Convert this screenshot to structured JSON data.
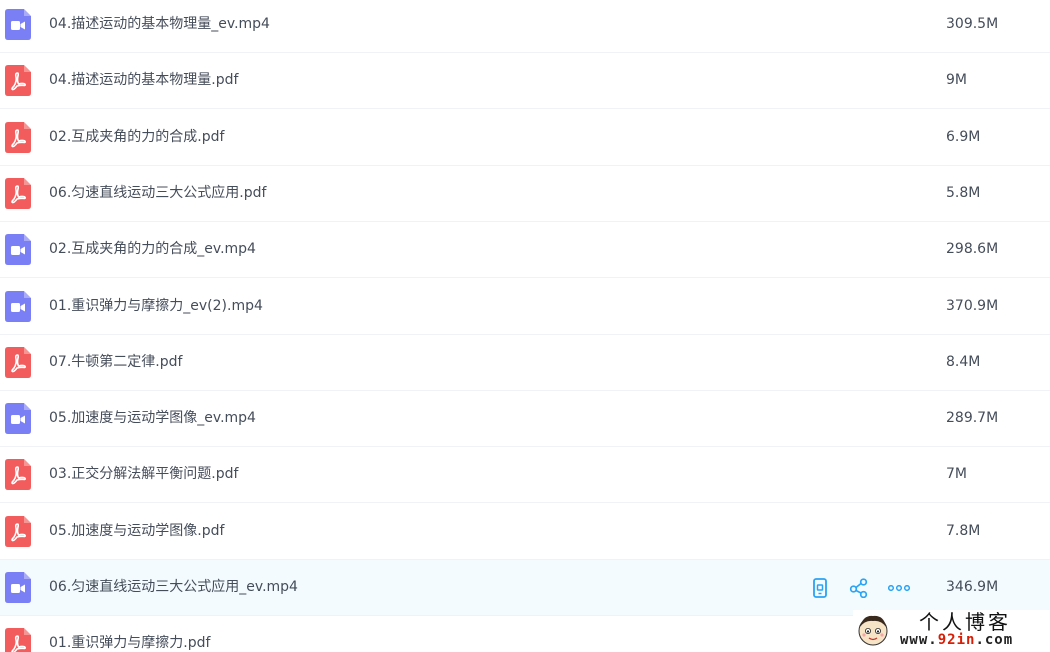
{
  "files": [
    {
      "name": "04.描述运动的基本物理量_ev.mp4",
      "size": "309.5M",
      "type": "video"
    },
    {
      "name": "04.描述运动的基本物理量.pdf",
      "size": "9M",
      "type": "pdf"
    },
    {
      "name": "02.互成夹角的力的合成.pdf",
      "size": "6.9M",
      "type": "pdf"
    },
    {
      "name": "06.匀速直线运动三大公式应用.pdf",
      "size": "5.8M",
      "type": "pdf"
    },
    {
      "name": "02.互成夹角的力的合成_ev.mp4",
      "size": "298.6M",
      "type": "video"
    },
    {
      "name": "01.重识弹力与摩擦力_ev(2).mp4",
      "size": "370.9M",
      "type": "video"
    },
    {
      "name": "07.牛顿第二定律.pdf",
      "size": "8.4M",
      "type": "pdf"
    },
    {
      "name": "05.加速度与运动学图像_ev.mp4",
      "size": "289.7M",
      "type": "video"
    },
    {
      "name": "03.正交分解法解平衡问题.pdf",
      "size": "7M",
      "type": "pdf"
    },
    {
      "name": "05.加速度与运动学图像.pdf",
      "size": "7.8M",
      "type": "pdf"
    },
    {
      "name": "06.匀速直线运动三大公式应用_ev.mp4",
      "size": "346.9M",
      "type": "video",
      "hovered": true
    },
    {
      "name": "01.重识弹力与摩擦力.pdf",
      "size": "",
      "type": "pdf"
    }
  ],
  "row_actions": {
    "icons": [
      "mobile-phone-icon",
      "share-icon",
      "more-icon"
    ]
  },
  "colors": {
    "video_icon": "#7b7ff5",
    "pdf_icon": "#f35c5c",
    "action_icon": "#2aa4f4",
    "text": "#454d5a",
    "hover_row": "#f4fbff"
  },
  "watermark": {
    "title": "个人博客",
    "url_prefix": "www.",
    "url_accent": "92in",
    "url_suffix": ".com"
  }
}
